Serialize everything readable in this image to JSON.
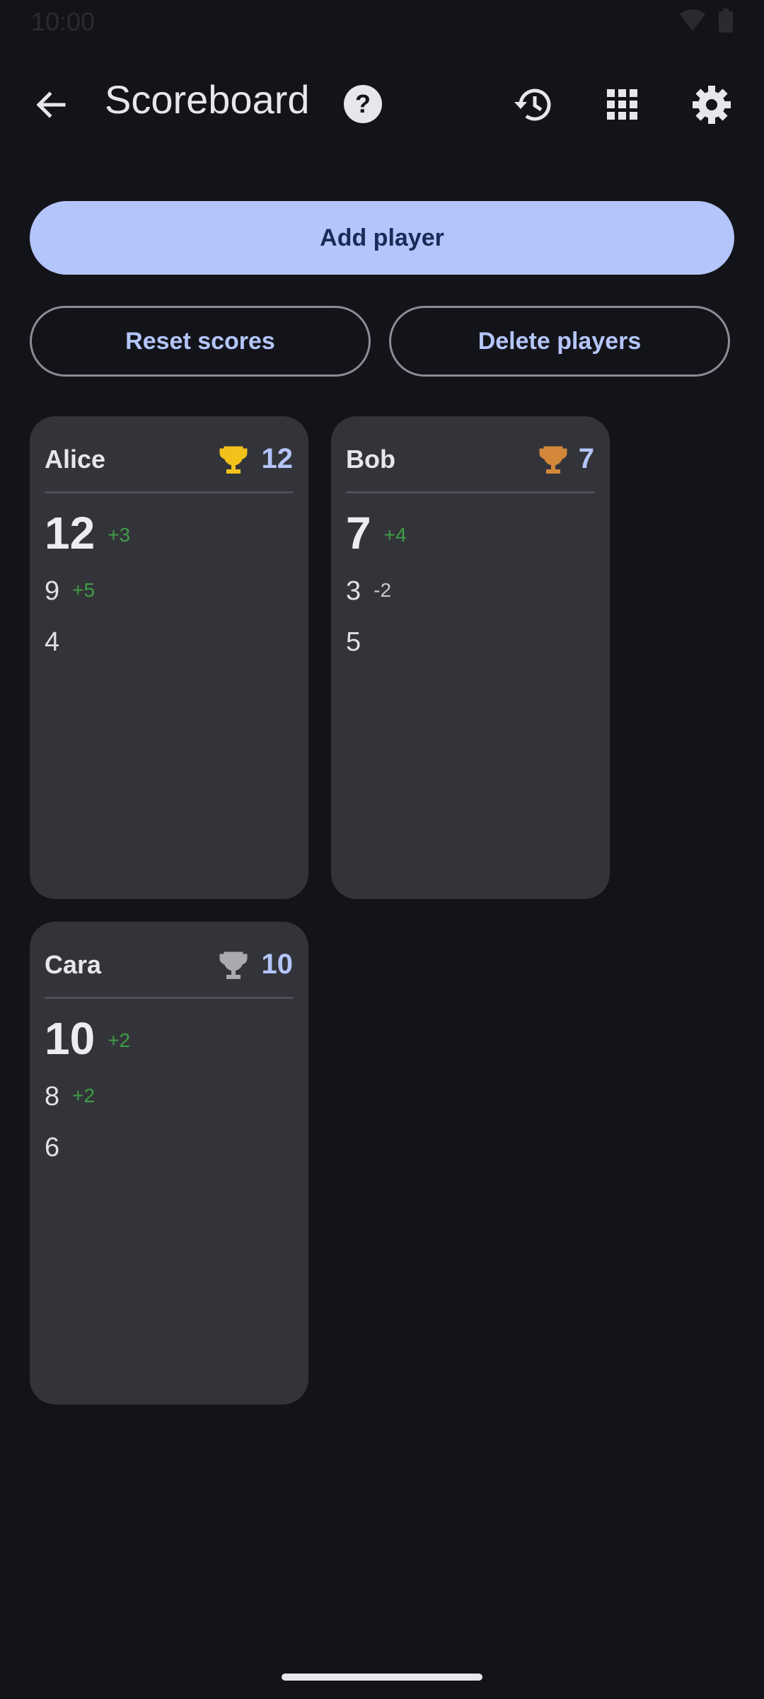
{
  "status_bar": {
    "time": "10:00"
  },
  "app_bar": {
    "title": "Scoreboard",
    "icons": {
      "back": "arrow-left-icon",
      "help": "help-circle-icon",
      "history": "history-icon",
      "grid": "grid-icon",
      "settings": "gear-icon"
    }
  },
  "buttons": {
    "add_player": "Add player",
    "reset_scores": "Reset scores",
    "delete_players": "Delete players"
  },
  "colors": {
    "gold": "#f2c21b",
    "bronze": "#d3873a",
    "silver": "#a9a9b0",
    "accent": "#b4c5fb",
    "positive": "#3f9d45"
  },
  "players": [
    {
      "name": "Alice",
      "total": "12",
      "trophy": "gold",
      "current": "12",
      "current_delta": "+3",
      "history": [
        {
          "value": "9",
          "delta": "+5"
        },
        {
          "value": "4",
          "delta": ""
        }
      ]
    },
    {
      "name": "Bob",
      "total": "7",
      "trophy": "bronze",
      "current": "7",
      "current_delta": "+4",
      "history": [
        {
          "value": "3",
          "delta": "-2"
        },
        {
          "value": "5",
          "delta": ""
        }
      ]
    },
    {
      "name": "Cara",
      "total": "10",
      "trophy": "silver",
      "current": "10",
      "current_delta": "+2",
      "history": [
        {
          "value": "8",
          "delta": "+2"
        },
        {
          "value": "6",
          "delta": ""
        }
      ]
    }
  ]
}
